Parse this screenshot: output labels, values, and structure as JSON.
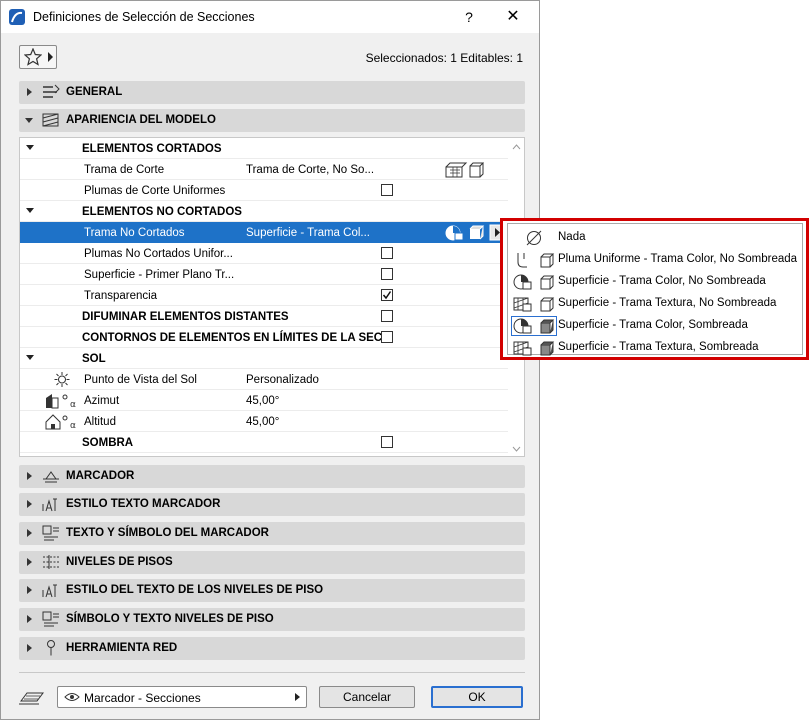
{
  "window": {
    "title": "Definiciones de Selección de Secciones",
    "help": "?",
    "close": "✕",
    "selection_info": "Seleccionados: 1 Editables: 1"
  },
  "panels_top": [
    {
      "label": "GENERAL"
    },
    {
      "label": "APARIENCIA DEL MODELO"
    }
  ],
  "tree": {
    "rows": [
      {
        "type": "group",
        "label": "ELEMENTOS CORTADOS"
      },
      {
        "type": "item",
        "name": "Trama de Corte",
        "value": "Trama de Corte, No So..."
      },
      {
        "type": "item",
        "name": "Plumas de Corte Uniformes",
        "checked": false
      },
      {
        "type": "group",
        "label": "ELEMENTOS NO CORTADOS"
      },
      {
        "type": "item",
        "name": "Trama No Cortados",
        "value": "Superficie - Trama Col...",
        "selected": true
      },
      {
        "type": "item",
        "name": "Plumas No Cortados Unifor...",
        "checked": false
      },
      {
        "type": "item",
        "name": "Superficie - Primer Plano Tr...",
        "checked": false
      },
      {
        "type": "item",
        "name": "Transparencia",
        "checked": true
      },
      {
        "type": "group2",
        "label": "DIFUMINAR ELEMENTOS DISTANTES",
        "checked": false
      },
      {
        "type": "group2",
        "label": "CONTORNOS DE ELEMENTOS EN LÍMITES DE LA SEC...",
        "checked": false
      },
      {
        "type": "group",
        "label": "SOL"
      },
      {
        "type": "item",
        "name": "Punto de Vista del Sol",
        "value": "Personalizado"
      },
      {
        "type": "item",
        "name": "Azimut",
        "value": "45,00°"
      },
      {
        "type": "item",
        "name": "Altitud",
        "value": "45,00°"
      },
      {
        "type": "group2",
        "label": "SOMBRA",
        "checked": false
      }
    ]
  },
  "panels_bottom": [
    {
      "label": "MARCADOR"
    },
    {
      "label": "ESTILO TEXTO MARCADOR"
    },
    {
      "label": "TEXTO Y SÍMBOLO DEL MARCADOR"
    },
    {
      "label": "NIVELES DE PISOS"
    },
    {
      "label": "ESTILO DEL TEXTO DE LOS NIVELES DE PISO"
    },
    {
      "label": "SÍMBOLO Y TEXTO NIVELES DE PISO"
    },
    {
      "label": "HERRAMIENTA RED"
    }
  ],
  "footer": {
    "favorite_combo": "Marcador - Secciones",
    "cancel": "Cancelar",
    "ok": "OK"
  },
  "popup": {
    "items": [
      "Nada",
      "Pluma Uniforme - Trama Color, No Sombreada",
      "Superficie - Trama Color, No Sombreada",
      "Superficie - Trama Textura, No Sombreada",
      "Superficie - Trama Color, Sombreada",
      "Superficie - Trama Textura, Sombreada"
    ],
    "highlight_color": "#d20000"
  },
  "colors": {
    "selection": "#1e72c8",
    "panel": "#d8d8d8",
    "ok_border": "#2a6fd0"
  }
}
